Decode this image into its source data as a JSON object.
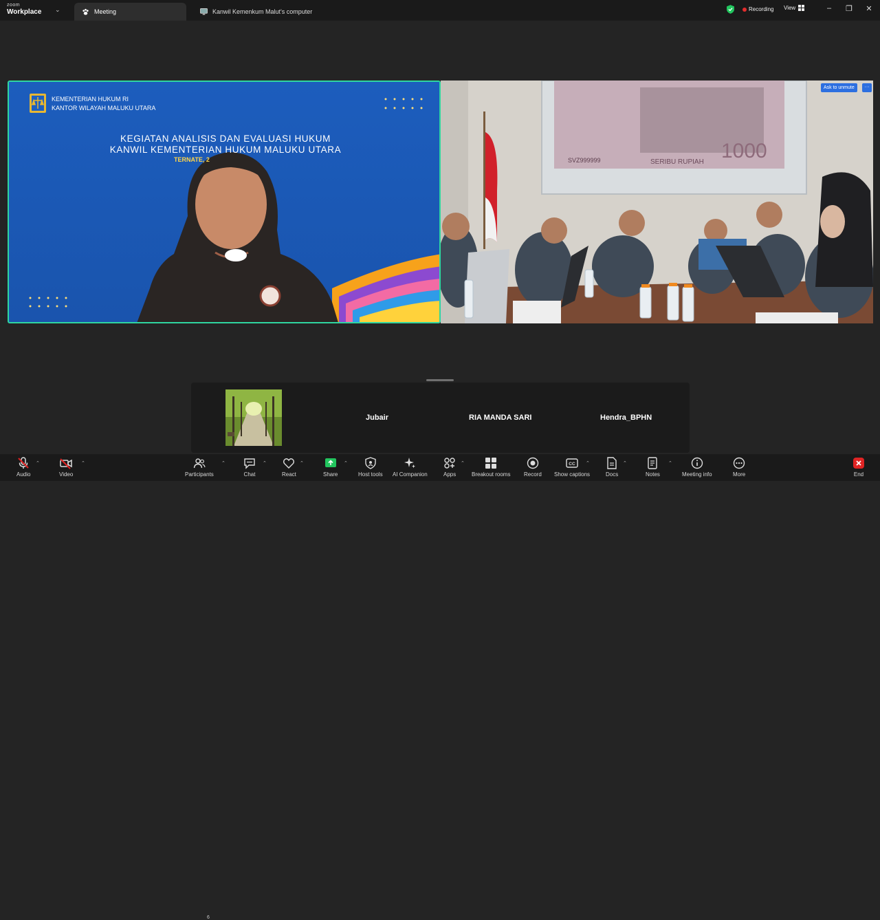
{
  "titlebar": {
    "brand_top": "zoom",
    "brand_bottom": "Workplace",
    "tabs": [
      {
        "label": "Meeting",
        "active": true
      },
      {
        "label": "Kanwil Kemenkum Malut's computer",
        "active": false
      }
    ],
    "recording_label": "Recording",
    "view_label": "View"
  },
  "shared_screen": {
    "org_line1": "KEMENTERIAN HUKUM RI",
    "org_line2": "KANTOR WILAYAH MALUKU UTARA",
    "title_line1": "KEGIATAN ANALISIS DAN EVALUASI HUKUM",
    "title_line2": "KANWIL KEMENTERIAN HUKUM MALUKU UTARA",
    "subtitle": "TERNATE, 2"
  },
  "room_video": {
    "ask_to_unmute": "Ask to unmute",
    "more": "···",
    "banknote_serial": "SVZ999999",
    "banknote_value": "1000",
    "banknote_text": "SERIBU RUPIAH"
  },
  "participants": [
    {
      "name": "Jubair"
    },
    {
      "name": "RIA MANDA SARI"
    },
    {
      "name": "Hendra_BPHN"
    }
  ],
  "toolbar": {
    "audio": "Audio",
    "video": "Video",
    "participants": "Participants",
    "participant_count": "6",
    "chat": "Chat",
    "react": "React",
    "share": "Share",
    "host_tools": "Host tools",
    "ai_companion": "AI Companion",
    "apps": "Apps",
    "breakout_rooms": "Breakout rooms",
    "record": "Record",
    "show_captions": "Show captions",
    "docs": "Docs",
    "notes": "Notes",
    "meeting_info": "Meeting info",
    "more": "More",
    "end": "End"
  },
  "colors": {
    "active_speaker_border": "#2fd6a0",
    "slide_blue": "#1d5fc0",
    "share_green": "#22c55e",
    "end_red": "#e02424",
    "recording_red": "#e22d2d"
  }
}
